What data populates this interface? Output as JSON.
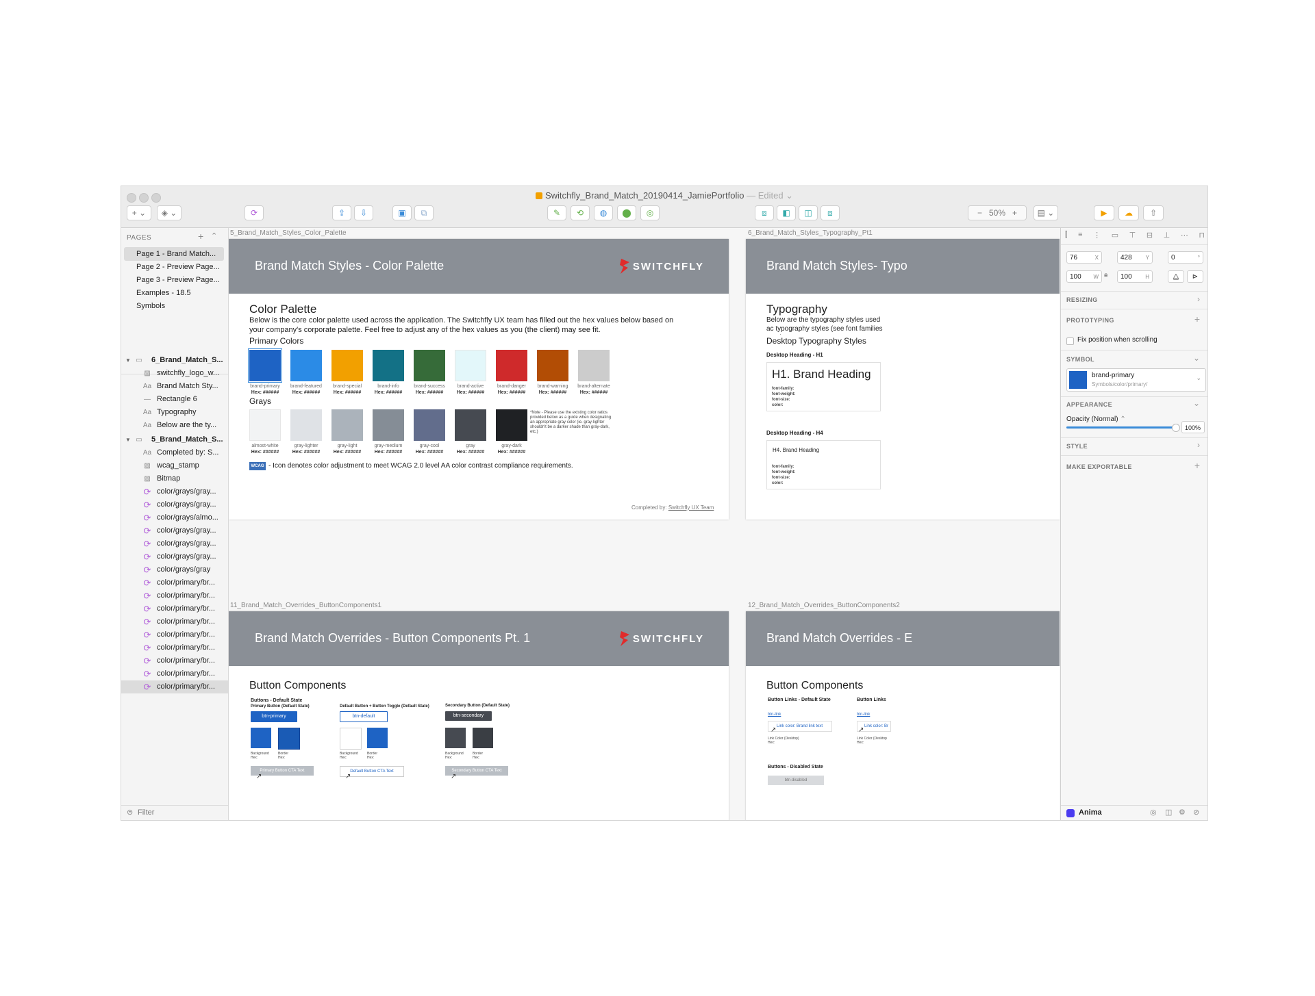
{
  "window": {
    "title": "Switchfly_Brand_Match_20190414_JamiePortfolio",
    "edited": "— Edited ⌄",
    "zoom": "50%"
  },
  "sidebar": {
    "pages_header": "PAGES",
    "pages": [
      "Page 1 - Brand Match...",
      "Page 2 - Preview Page...",
      "Page 3 - Preview Page...",
      "Examples - 18.5",
      "Symbols"
    ],
    "layers": [
      {
        "label": "6_Brand_Match_S...",
        "icon": "artboard-icon",
        "group": true
      },
      {
        "label": "switchfly_logo_w...",
        "icon": "image-icon"
      },
      {
        "label": "Brand Match Sty...",
        "icon": "text-icon"
      },
      {
        "label": "Rectangle 6",
        "icon": "line-icon"
      },
      {
        "label": "Typography",
        "icon": "text-icon"
      },
      {
        "label": "Below are the ty...",
        "icon": "text-icon"
      },
      {
        "label": "5_Brand_Match_S...",
        "icon": "artboard-icon",
        "group": true
      },
      {
        "label": "Completed by: S...",
        "icon": "text-icon"
      },
      {
        "label": "wcag_stamp",
        "icon": "image-icon"
      },
      {
        "label": "Bitmap",
        "icon": "image-icon"
      },
      {
        "label": "color/grays/gray...",
        "icon": "symbol-icon"
      },
      {
        "label": "color/grays/gray...",
        "icon": "symbol-icon"
      },
      {
        "label": "color/grays/almo...",
        "icon": "symbol-icon"
      },
      {
        "label": "color/grays/gray...",
        "icon": "symbol-icon"
      },
      {
        "label": "color/grays/gray...",
        "icon": "symbol-icon"
      },
      {
        "label": "color/grays/gray...",
        "icon": "symbol-icon"
      },
      {
        "label": "color/grays/gray",
        "icon": "symbol-icon"
      },
      {
        "label": "color/primary/br...",
        "icon": "symbol-icon"
      },
      {
        "label": "color/primary/br...",
        "icon": "symbol-icon"
      },
      {
        "label": "color/primary/br...",
        "icon": "symbol-icon"
      },
      {
        "label": "color/primary/br...",
        "icon": "symbol-icon"
      },
      {
        "label": "color/primary/br...",
        "icon": "symbol-icon"
      },
      {
        "label": "color/primary/br...",
        "icon": "symbol-icon"
      },
      {
        "label": "color/primary/br...",
        "icon": "symbol-icon"
      },
      {
        "label": "color/primary/br...",
        "icon": "symbol-icon"
      },
      {
        "label": "color/primary/br...",
        "icon": "symbol-icon",
        "selected": true
      }
    ],
    "filter": "Filter"
  },
  "canvas": {
    "artboard1": {
      "label": "5_Brand_Match_Styles_Color_Palette",
      "header": "Brand Match Styles - Color Palette",
      "logo": "SWITCHFLY",
      "title": "Color Palette",
      "intro": "Below is the core color palette used across the application. The Switchfly UX team has filled out the hex values below based on your company's corporate palette. Feel free to adjust any of the hex values as you (the client) may see fit.",
      "primary_heading": "Primary Colors",
      "primary": [
        {
          "name": "brand-primary",
          "hex": "Hex: ######",
          "color": "#1e63c4"
        },
        {
          "name": "brand-featured",
          "hex": "Hex: ######",
          "color": "#2b8be6"
        },
        {
          "name": "brand-special",
          "hex": "Hex: ######",
          "color": "#f2a000"
        },
        {
          "name": "brand-info",
          "hex": "Hex: ######",
          "color": "#137186"
        },
        {
          "name": "brand-success",
          "hex": "Hex: ######",
          "color": "#366b39"
        },
        {
          "name": "brand-active",
          "hex": "Hex: ######",
          "color": "#e3f7fa"
        },
        {
          "name": "brand-danger",
          "hex": "Hex: ######",
          "color": "#cf2a2b"
        },
        {
          "name": "brand-warning",
          "hex": "Hex: ######",
          "color": "#b24d05"
        },
        {
          "name": "brand-alternate",
          "hex": "Hex: ######",
          "color": "#cccccc"
        }
      ],
      "grays_heading": "Grays",
      "grays": [
        {
          "name": "almost-white",
          "hex": "Hex: ######",
          "color": "#f2f3f4"
        },
        {
          "name": "gray-lighter",
          "hex": "Hex: ######",
          "color": "#dfe2e6"
        },
        {
          "name": "gray-light",
          "hex": "Hex: ######",
          "color": "#abb3bb"
        },
        {
          "name": "gray-medium",
          "hex": "Hex: ######",
          "color": "#858d96"
        },
        {
          "name": "gray-cool",
          "hex": "Hex: ######",
          "color": "#626d8c"
        },
        {
          "name": "gray",
          "hex": "Hex: ######",
          "color": "#464a51"
        },
        {
          "name": "gray-dark",
          "hex": "Hex: ######",
          "color": "#1f2124"
        }
      ],
      "note": "*Note - Please use the existing color ratios provided below as a guide when designating an appropriate gray color (ie. gray-lighter shouldn't be a darker shade than gray-dark, etc.)",
      "wcag_badge": "WCAG",
      "wcag_text": "- Icon denotes color adjustment to meet WCAG 2.0 level AA color contrast compliance requirements.",
      "completed_by": "Completed by:",
      "completed_link": "Switchfly UX Team"
    },
    "artboard2": {
      "label": "6_Brand_Match_Styles_Typography_Pt1",
      "header": "Brand Match Styles- Typo",
      "title": "Typography",
      "intro": "Below are the typography styles used ac typography styles (see font families used",
      "subheading": "Desktop Typography Styles",
      "h1_label": "Desktop Heading - H1",
      "h1_sample": "H1. Brand Heading",
      "h4_label": "Desktop Heading - H4",
      "h4_sample": "H4. Brand Heading",
      "props": [
        "font-family:",
        "font-weight:",
        "font-size:",
        "color:"
      ]
    },
    "artboard3": {
      "label": "11_Brand_Match_Overrides_ButtonComponents1",
      "header": "Brand Match Overrides - Button Components Pt. 1",
      "logo": "SWITCHFLY",
      "title": "Button Components",
      "col1_heading": "Buttons - Default State",
      "col1_sub": "Primary Button (Default State)",
      "col1_btn": "btn-primary",
      "col2_sub": "Default Button + Button Toggle (Default State)",
      "col2_btn": "btn-default",
      "col3_sub": "Secondary Button (Default State)",
      "col3_btn": "btn-secondary",
      "bg_label": "Background",
      "border_label": "Border",
      "hex_label": "Hex:",
      "cta1": "Primary Button CTA Text",
      "cta2": "Default Button CTA Text",
      "cta3": "Secondary Button CTA Text",
      "text_color": "CTA Text Color"
    },
    "artboard4": {
      "label": "12_Brand_Match_Overrides_ButtonComponents2",
      "header": "Brand Match Overrides - E",
      "title": "Button Components",
      "links_default": "Button Links - Default State",
      "links_right": "Button Links",
      "btn_link": "btn-link",
      "link_text": "Link color: Brand link text",
      "link_text2": "Link color: Br",
      "link_desktop": "Link Color (Desktop)",
      "link_desktop2": "Link Color (Desktop",
      "hex_label": "Hex:",
      "disabled_heading": "Buttons - Disabled State",
      "disabled_btn": "btn-disabled"
    }
  },
  "inspector": {
    "x": "76",
    "x_unit": "X",
    "y": "428",
    "y_unit": "Y",
    "rot": "0",
    "rot_unit": "°",
    "w": "100",
    "w_unit": "W",
    "h": "100",
    "h_unit": "H",
    "resizing": "RESIZING",
    "prototyping": "PROTOTYPING",
    "fix_position": "Fix position when scrolling",
    "symbol": "SYMBOL",
    "symbol_name": "brand-primary",
    "symbol_path": "Symbols/color/primary/",
    "symbol_color": "#1e63c4",
    "appearance": "APPEARANCE",
    "opacity_label": "Opacity (Normal)",
    "opacity_value": "100%",
    "opacity_level": 1.0,
    "style": "STYLE",
    "make_exportable": "MAKE EXPORTABLE",
    "plugin": "Anima"
  }
}
